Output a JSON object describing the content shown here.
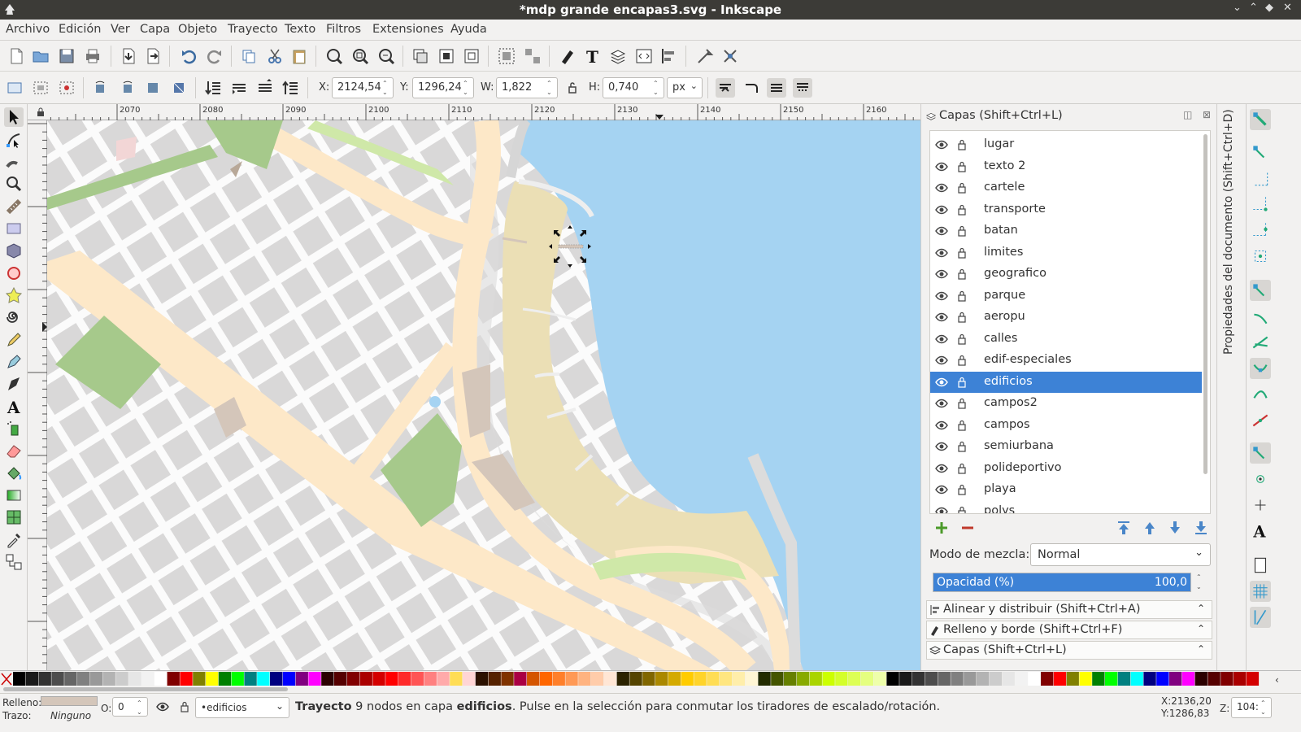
{
  "window": {
    "title": "*mdp grande encapas3.svg - Inkscape",
    "app_icon": "inkscape-icon"
  },
  "menu": [
    "Archivo",
    "Edición",
    "Ver",
    "Capa",
    "Objeto",
    "Trayecto",
    "Texto",
    "Filtros",
    "Extensiones",
    "Ayuda"
  ],
  "controls": {
    "x_label": "X:",
    "x_value": "2124,54",
    "y_label": "Y:",
    "y_value": "1296,24",
    "w_label": "W:",
    "w_value": "1,822",
    "h_label": "H:",
    "h_value": "0,740",
    "unit": "px"
  },
  "ruler": {
    "ticks": [
      "2070",
      "2080",
      "2090",
      "2100",
      "2110",
      "2120",
      "2130",
      "2140",
      "2150",
      "2160"
    ]
  },
  "layers_panel": {
    "title": "Capas (Shift+Ctrl+L)",
    "layers": [
      "lugar",
      "texto 2",
      "cartele",
      "transporte",
      "batan",
      "limites",
      "geografico",
      "parque",
      "aeropu",
      "calles",
      "edif-especiales",
      "edificios",
      "campos2",
      "campos",
      "semiurbana",
      "polideportivo",
      "playa",
      "polys"
    ],
    "selected": "edificios",
    "blend_label": "Modo de mezcla:",
    "blend_value": "Normal",
    "opacity_label": "Opacidad (%)",
    "opacity_value": "100,0",
    "opacity_fraction": 1.0
  },
  "collapsed_panels": [
    "Alinear y distribuir (Shift+Ctrl+A)",
    "Relleno y borde (Shift+Ctrl+F)",
    "Capas (Shift+Ctrl+L)"
  ],
  "side_tab": "Propiedades del documento (Shift+Ctrl+D)",
  "status": {
    "fill_label": "Relleno:",
    "stroke_label": "Trazo:",
    "stroke_value": "Ninguno",
    "opacity_label": "O:",
    "opacity_value": "0",
    "layer_select": "•edificios",
    "message_bold1": "Trayecto",
    "message_mid": " 9 nodos en capa ",
    "message_bold2": "edificios",
    "message_end": ". Pulse en la selección para conmutar los tiradores de escalado/rotación.",
    "cursor_x": "X:2136,20",
    "cursor_y": "Y:1286,83",
    "zoom_label": "Z:",
    "zoom_value": "104:"
  },
  "colors": {
    "fill_swatch": "#d4c6ba",
    "selection": "#3d82d6",
    "water": "#a5d3f2",
    "sand": "#ebdfb5",
    "road": "#fde8c8",
    "park": "#a6c98b",
    "block": "#d8d7d7"
  }
}
